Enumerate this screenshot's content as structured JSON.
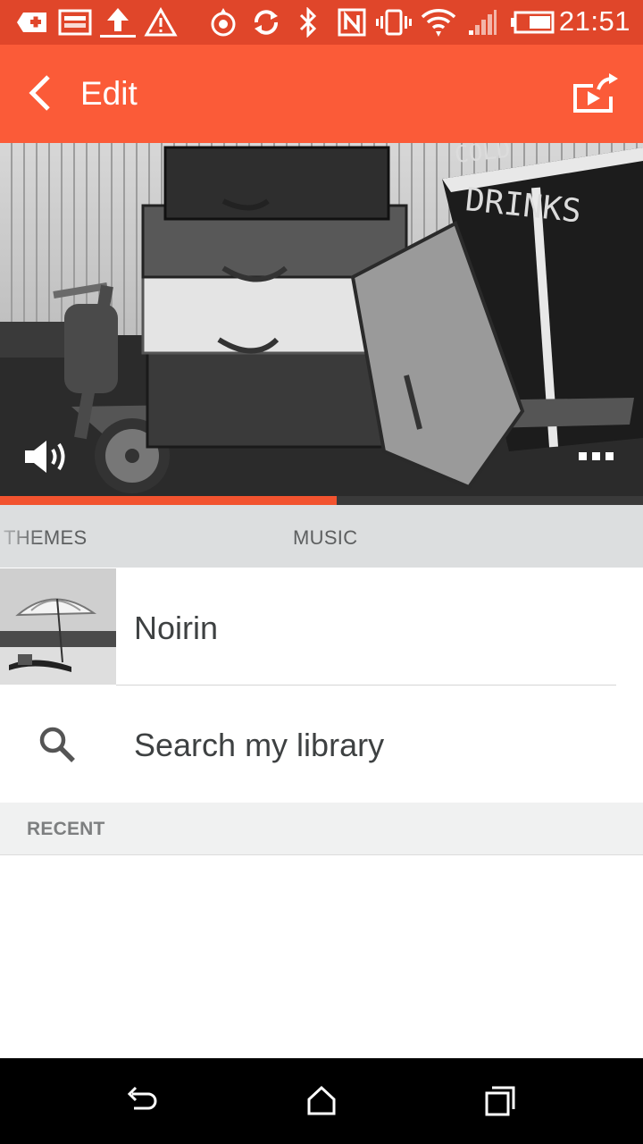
{
  "status_bar": {
    "time": "21:51",
    "icons": [
      "medical-cross-icon",
      "image-icon",
      "upload-icon",
      "warning-icon",
      "location-target-icon",
      "sync-icon",
      "bluetooth-icon",
      "nfc-icon",
      "vibrate-icon",
      "wifi-icon",
      "signal-icon",
      "battery-icon"
    ]
  },
  "app_bar": {
    "title": "Edit",
    "back_icon": "chevron-left-icon",
    "share_icon": "share-video-icon"
  },
  "player": {
    "volume_icon": "speaker-icon",
    "more_icon": "more-dots-icon",
    "progress": 0.523,
    "accent": "#f2532f"
  },
  "tabs": [
    {
      "label": "THEMES"
    },
    {
      "label": "MUSIC"
    }
  ],
  "list": {
    "theme_item": {
      "label": "Noirin"
    },
    "search_item": {
      "label": "Search my library",
      "icon": "search-icon"
    }
  },
  "section": {
    "recent_label": "RECENT"
  },
  "nav_bar": {
    "icons": [
      "back-icon",
      "home-icon",
      "recents-icon"
    ]
  },
  "colors": {
    "status_bar": "#e0462a",
    "app_bar": "#fb5b38",
    "tab_bar": "#dcdedf",
    "section_header": "#f0f1f1"
  }
}
